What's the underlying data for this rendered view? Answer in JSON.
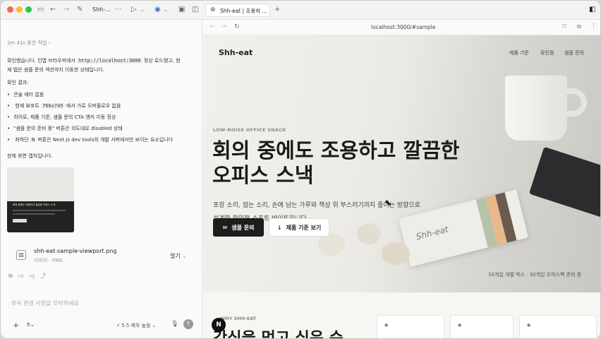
{
  "titlebar": {
    "chat_title": "Shh-...",
    "tab_title": "Shh-eat | 조용히 ..."
  },
  "left": {
    "duration": "2m 41s 동안 작업",
    "intro_a": "확인했습니다. 인앱 브라우저에서",
    "intro_code": "http://localhost:3000",
    "intro_b": "정상 로드됐고, 현",
    "intro_line2": "재 탭은 샘플 문의 섹션까지 이동한 상태입니다.",
    "result_title": "확인 결과:",
    "b1": "콘솔 에러 없음",
    "b2_a": "현재 뷰포트",
    "b2_code": "766x745",
    "b2_b": "에서 가로 오버플로우 없음",
    "b3": "히어로, 제품 기준, 샘플 문의 CTA 앵커 이동 정상",
    "b4": "\"샘플 문의 준비 중\" 버튼은 의도대로 disabled 상태",
    "b5_a": "좌하단",
    "b5_code": "N",
    "b5_b": "버튼은 Next.js dev tools의 개발 서버에서만 보이는 요소입니다",
    "capture": "현재 화면 캡처입니다.",
    "thumb_heading": "회의 중에도 조용하고 깔끔한 오피스 스낵",
    "file_name": "shh-eat-sample-viewport.png",
    "file_type": "이미지 · PNG",
    "open_label": "열기",
    "input_placeholder": "후속 변경 사항을 부탁하세요",
    "model_label": "5.5 매우 높음"
  },
  "browser": {
    "url": "localhost:3000/#sample"
  },
  "site": {
    "logo": "Shh-eat",
    "nav1": "제품 기준",
    "nav2": "확인점",
    "nav3": "샘플 문의",
    "eyebrow": "LOW-NOISE OFFICE SNACK",
    "h1_line1": "회의 중에도 조용하고 깔끔한",
    "h1_line2": "오피스 스낵",
    "desc1": "포장 소리, 씹는 소리, 손에 남는 가루와 책상 위 부스러기까지 줄이는 방향으로",
    "desc2": "설계한 한입형 소프트 바이트입니다.",
    "cta_primary": "샘플 문의",
    "cta_secondary": "제품 기준 보기",
    "package_text": "Shh-eat",
    "caption": "10개입 개별 박스 · 30개입 오피스팩 준비 중",
    "section_eyebrow": "WHY SHH-EAT",
    "section_h2": "간식을 먹고 싶은 순",
    "devtools": "N"
  },
  "colors": {
    "accent_dark": "#1d1d1d",
    "traffic_red": "#ff5f57",
    "traffic_yellow": "#febc2e",
    "traffic_green": "#28c840"
  }
}
